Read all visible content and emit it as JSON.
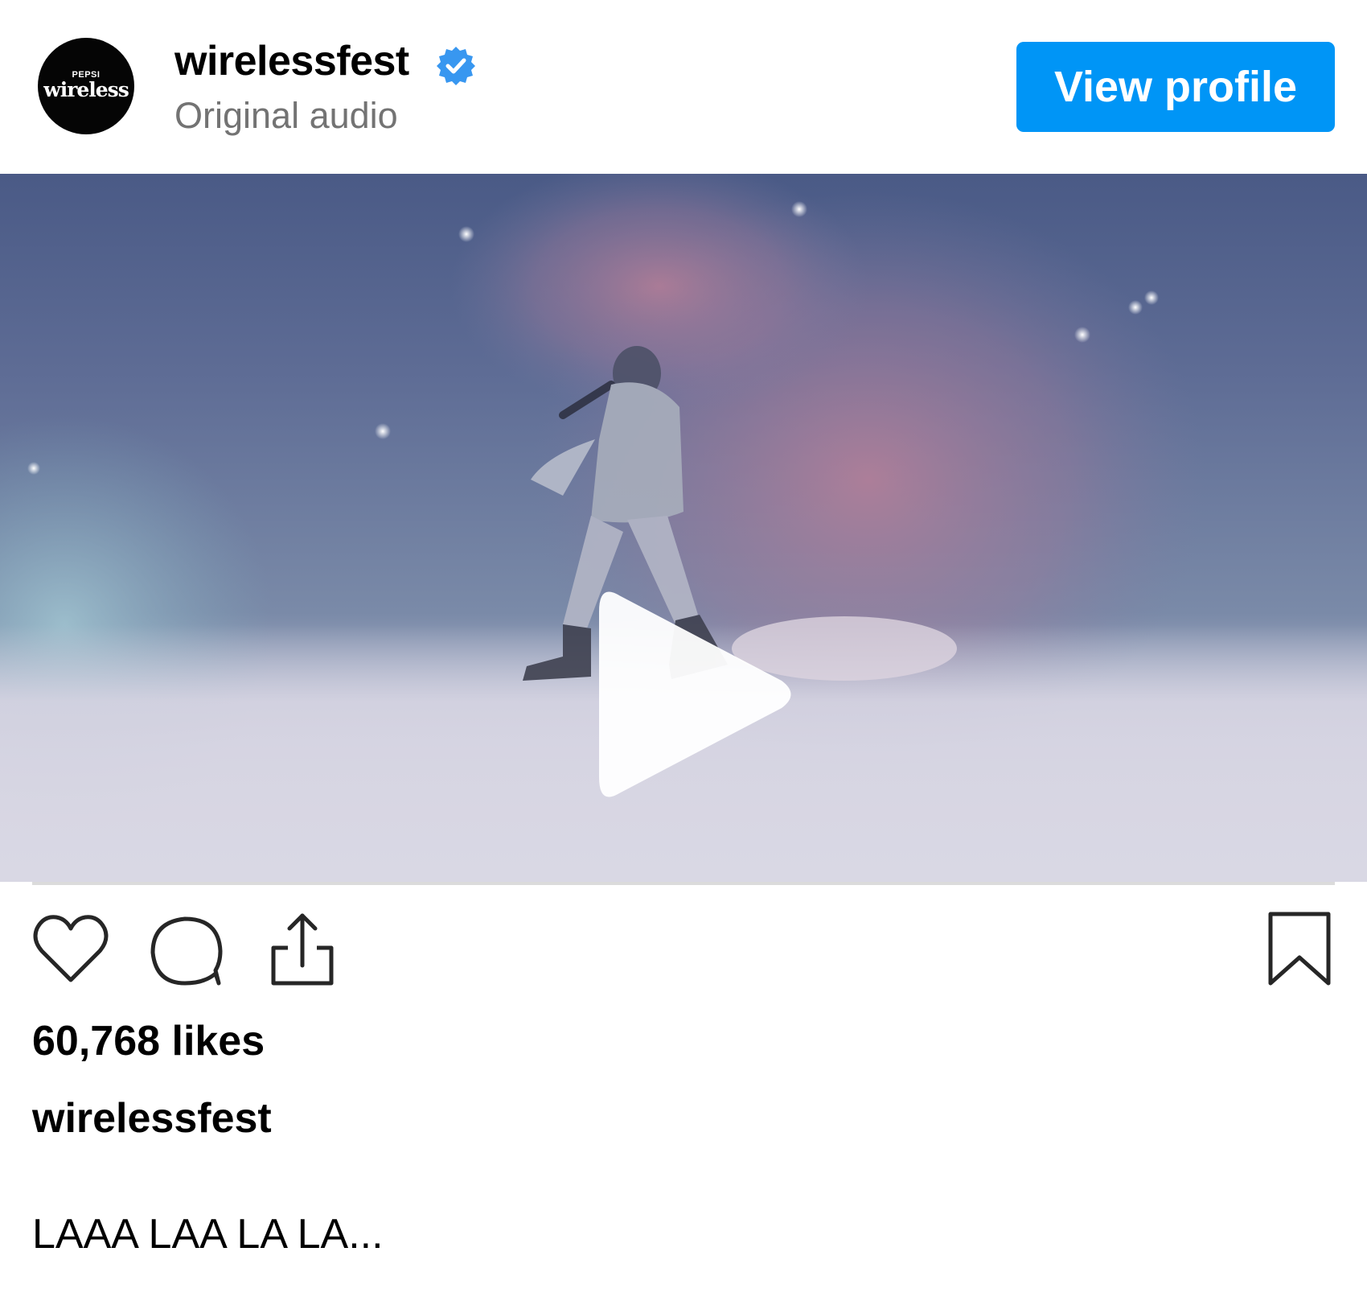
{
  "header": {
    "avatar_brand_top": "PEPSI",
    "avatar_brand_main": "wireless",
    "account_name": "wirelessfest",
    "verified_icon": "verified-badge-icon",
    "audio_label": "Original audio",
    "view_profile_label": "View profile"
  },
  "video": {
    "play_icon": "play-icon",
    "accent_color": "#0095f6"
  },
  "actions": {
    "like_icon": "heart-icon",
    "comment_icon": "comment-icon",
    "share_icon": "share-icon",
    "save_icon": "bookmark-icon"
  },
  "post": {
    "likes": "60,768 likes",
    "caption_user": "wirelessfest",
    "caption_text": "LAAA LAA LA LA..."
  },
  "colors": {
    "primary_button": "#0095f6",
    "secondary_text": "#737373",
    "verified_blue": "#3897f0"
  }
}
